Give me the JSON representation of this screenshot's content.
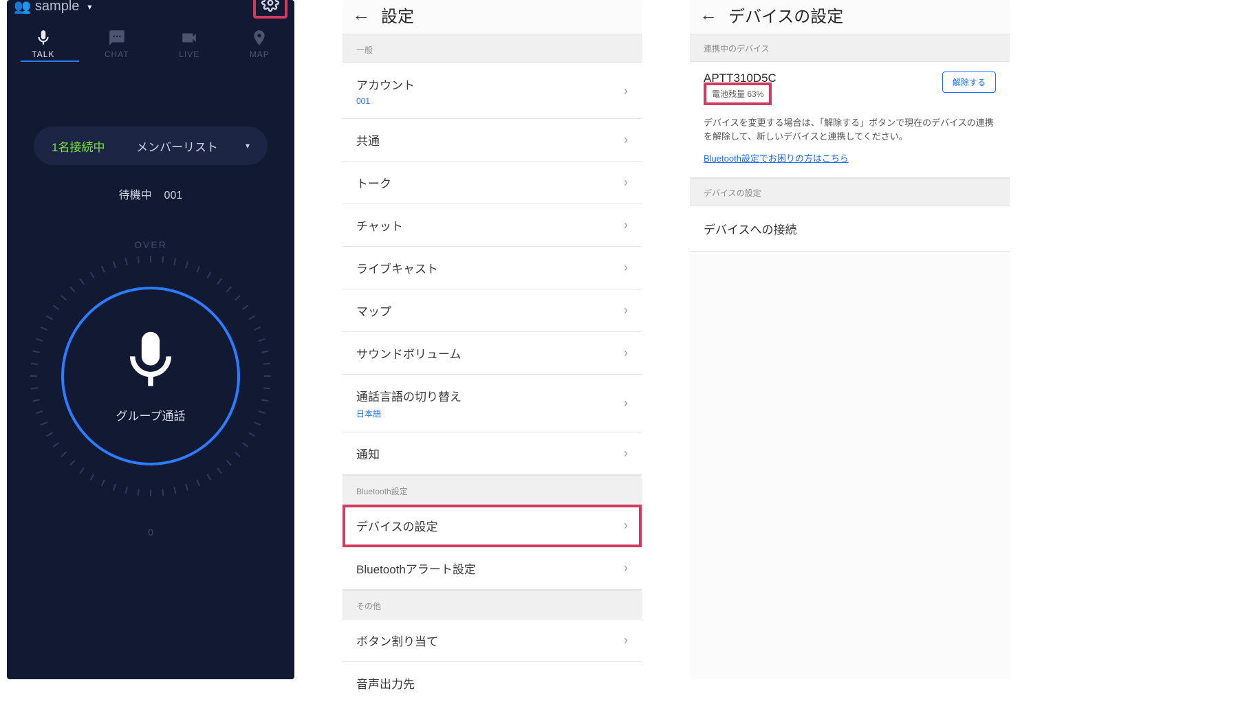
{
  "panel1": {
    "group_name": "sample",
    "tabs": [
      "TALK",
      "CHAT",
      "LIVE",
      "MAP"
    ],
    "connection_count": "1名接続中",
    "member_list": "メンバーリスト",
    "status_prefix": "待機中",
    "status_id": "001",
    "over": "OVER",
    "zero": "0",
    "call_label": "グループ通話"
  },
  "panel2": {
    "title": "設定",
    "sections": {
      "general": "一般",
      "bluetooth": "Bluetooth設定",
      "other": "その他"
    },
    "rows": {
      "account": {
        "label": "アカウント",
        "sub": "001"
      },
      "common": "共通",
      "talk": "トーク",
      "chat": "チャット",
      "livecast": "ライブキャスト",
      "map": "マップ",
      "sound": "サウンドボリューム",
      "lang": {
        "label": "通話言語の切り替え",
        "sub": "日本語"
      },
      "notify": "通知",
      "device": "デバイスの設定",
      "btalert": "Bluetoothアラート設定",
      "button_assign": "ボタン割り当て",
      "audio_out": "音声出力先"
    }
  },
  "panel3": {
    "title": "デバイスの設定",
    "section_label_paired": "連携中のデバイス",
    "device_name": "APTT310D5C",
    "battery": "電池残量 63%",
    "unpair": "解除する",
    "note": "デバイスを変更する場合は、「解除する」ボタンで現在のデバイスの連携を解除して、新しいデバイスと連携してください。",
    "bt_link": "Bluetooth設定でお困りの方はこちら",
    "section_label_settings": "デバイスの設定",
    "connect_row": "デバイスへの接続"
  }
}
